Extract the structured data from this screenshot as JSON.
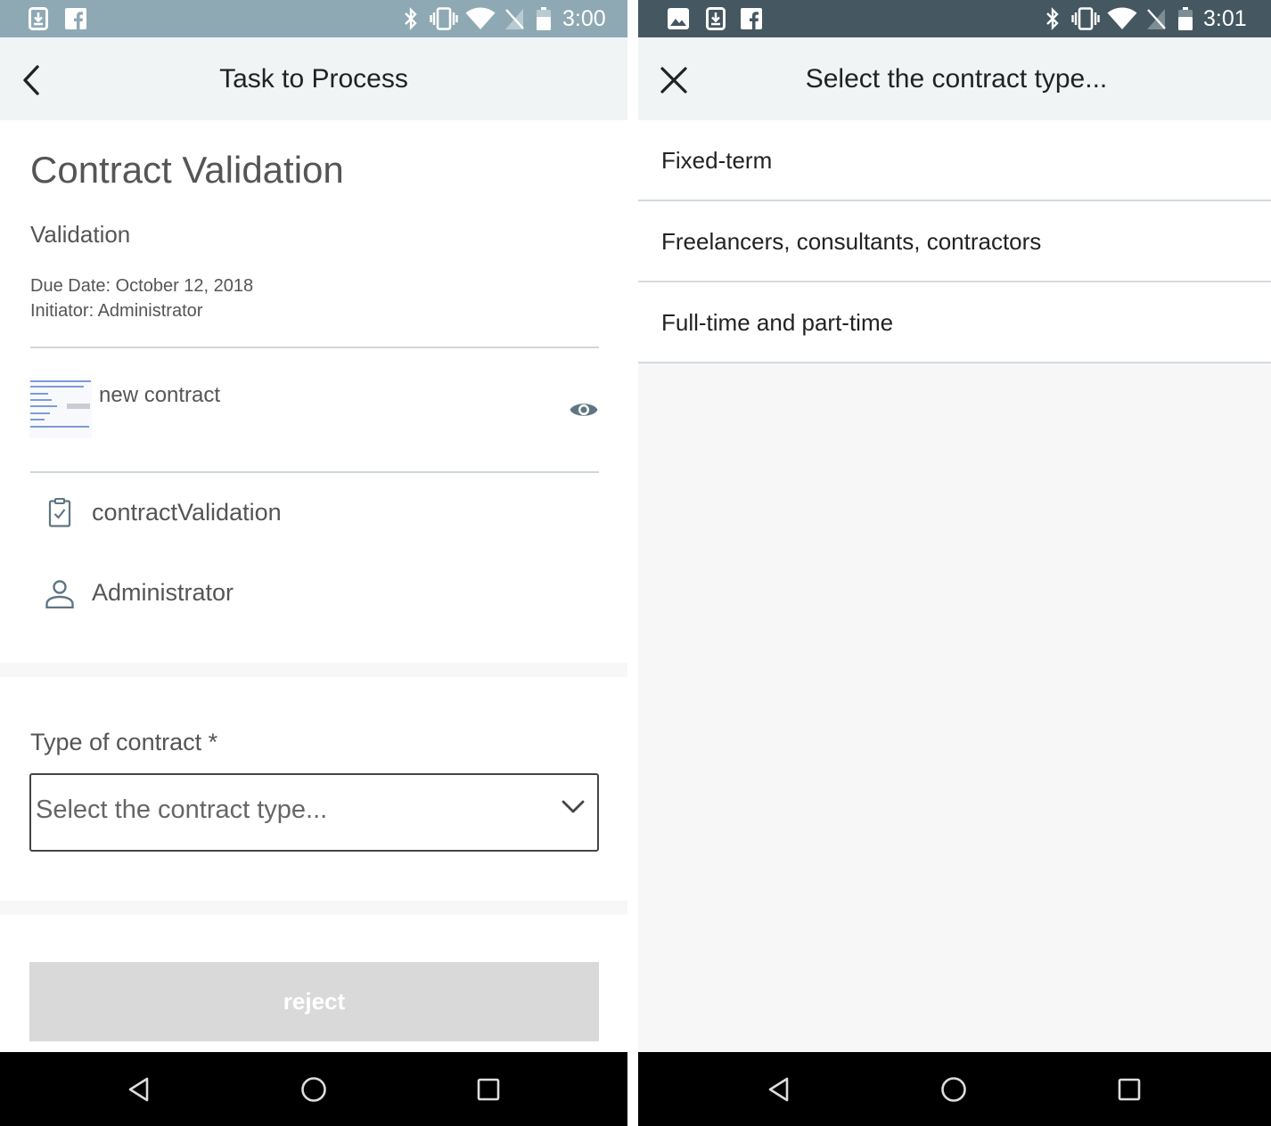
{
  "colors": {
    "status_left": "#8fa9b4",
    "status_right": "#455760",
    "app_bar": "#f0f4f5",
    "divider": "#cfd5d8",
    "disabled_button": "#d9d9d9",
    "nav_bar": "#000000"
  },
  "left_screen": {
    "status_bar": {
      "time": "3:00",
      "icons": [
        "download-icon",
        "facebook-icon",
        "bluetooth-icon",
        "vibrate-icon",
        "wifi-icon",
        "no-signal-icon",
        "battery-icon"
      ]
    },
    "app_bar": {
      "back_icon": "chevron-left-icon",
      "title": "Task to Process"
    },
    "task": {
      "title": "Contract Validation",
      "subtitle": "Validation",
      "due_date": "Due Date: October 12, 2018",
      "initiator": "Initiator: Administrator"
    },
    "document": {
      "name": "new contract",
      "preview_icon": "eye-icon"
    },
    "info": {
      "process_name": "contractValidation",
      "process_icon": "clipboard-check-icon",
      "assignee": "Administrator",
      "assignee_icon": "person-icon"
    },
    "form": {
      "field_label": "Type of contract *",
      "select_placeholder": "Select the contract type...",
      "select_icon": "chevron-down-icon"
    },
    "actions": {
      "reject_label": "reject"
    },
    "nav_bar": {
      "icons": [
        "back-triangle-icon",
        "home-circle-icon",
        "recents-square-icon"
      ]
    }
  },
  "right_screen": {
    "status_bar": {
      "time": "3:01",
      "icons": [
        "image-icon",
        "download-icon",
        "facebook-icon",
        "bluetooth-icon",
        "vibrate-icon",
        "wifi-icon",
        "no-signal-icon",
        "battery-icon"
      ]
    },
    "app_bar": {
      "close_icon": "close-icon",
      "title": "Select the contract type..."
    },
    "options": [
      {
        "label": "Fixed-term"
      },
      {
        "label": "Freelancers, consultants, contractors"
      },
      {
        "label": "Full-time and part-time"
      }
    ],
    "nav_bar": {
      "icons": [
        "back-triangle-icon",
        "home-circle-icon",
        "recents-square-icon"
      ]
    }
  }
}
